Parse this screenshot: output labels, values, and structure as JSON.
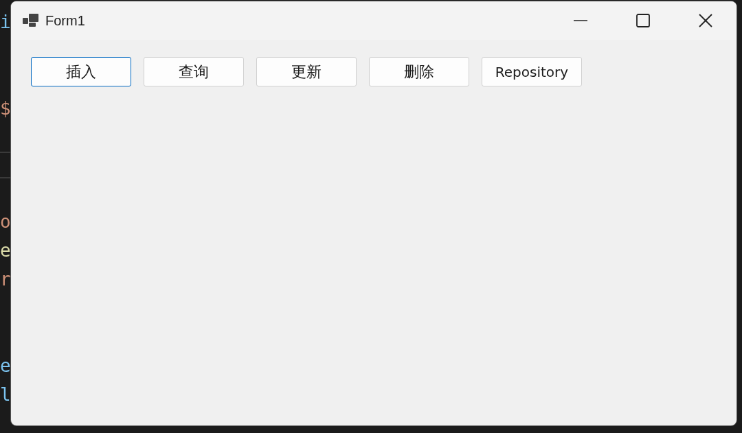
{
  "editor_lines": [
    {
      "kind": "code",
      "text": "i",
      "color": "#7cc4f0"
    },
    {
      "kind": "blank"
    },
    {
      "kind": "blank"
    },
    {
      "kind": "code",
      "text": "$",
      "color": "#ce9178"
    },
    {
      "kind": "blank"
    },
    {
      "kind": "rule"
    },
    {
      "kind": "rule"
    },
    {
      "kind": "blank"
    },
    {
      "kind": "code",
      "text": "o",
      "color": "#ce9178"
    },
    {
      "kind": "code",
      "text": "e",
      "color": "#dcdcaa"
    },
    {
      "kind": "code",
      "text": "r",
      "color": "#ce9178"
    },
    {
      "kind": "blank"
    },
    {
      "kind": "blank"
    },
    {
      "kind": "code",
      "text": "e",
      "color": "#7cc4f0"
    },
    {
      "kind": "code",
      "text": "l",
      "color": "#7cc4f0"
    }
  ],
  "window": {
    "title": "Form1"
  },
  "buttons": [
    {
      "label": "插入",
      "selected": true
    },
    {
      "label": "查询",
      "selected": false
    },
    {
      "label": "更新",
      "selected": false
    },
    {
      "label": "删除",
      "selected": false
    },
    {
      "label": "Repository",
      "selected": false
    }
  ]
}
